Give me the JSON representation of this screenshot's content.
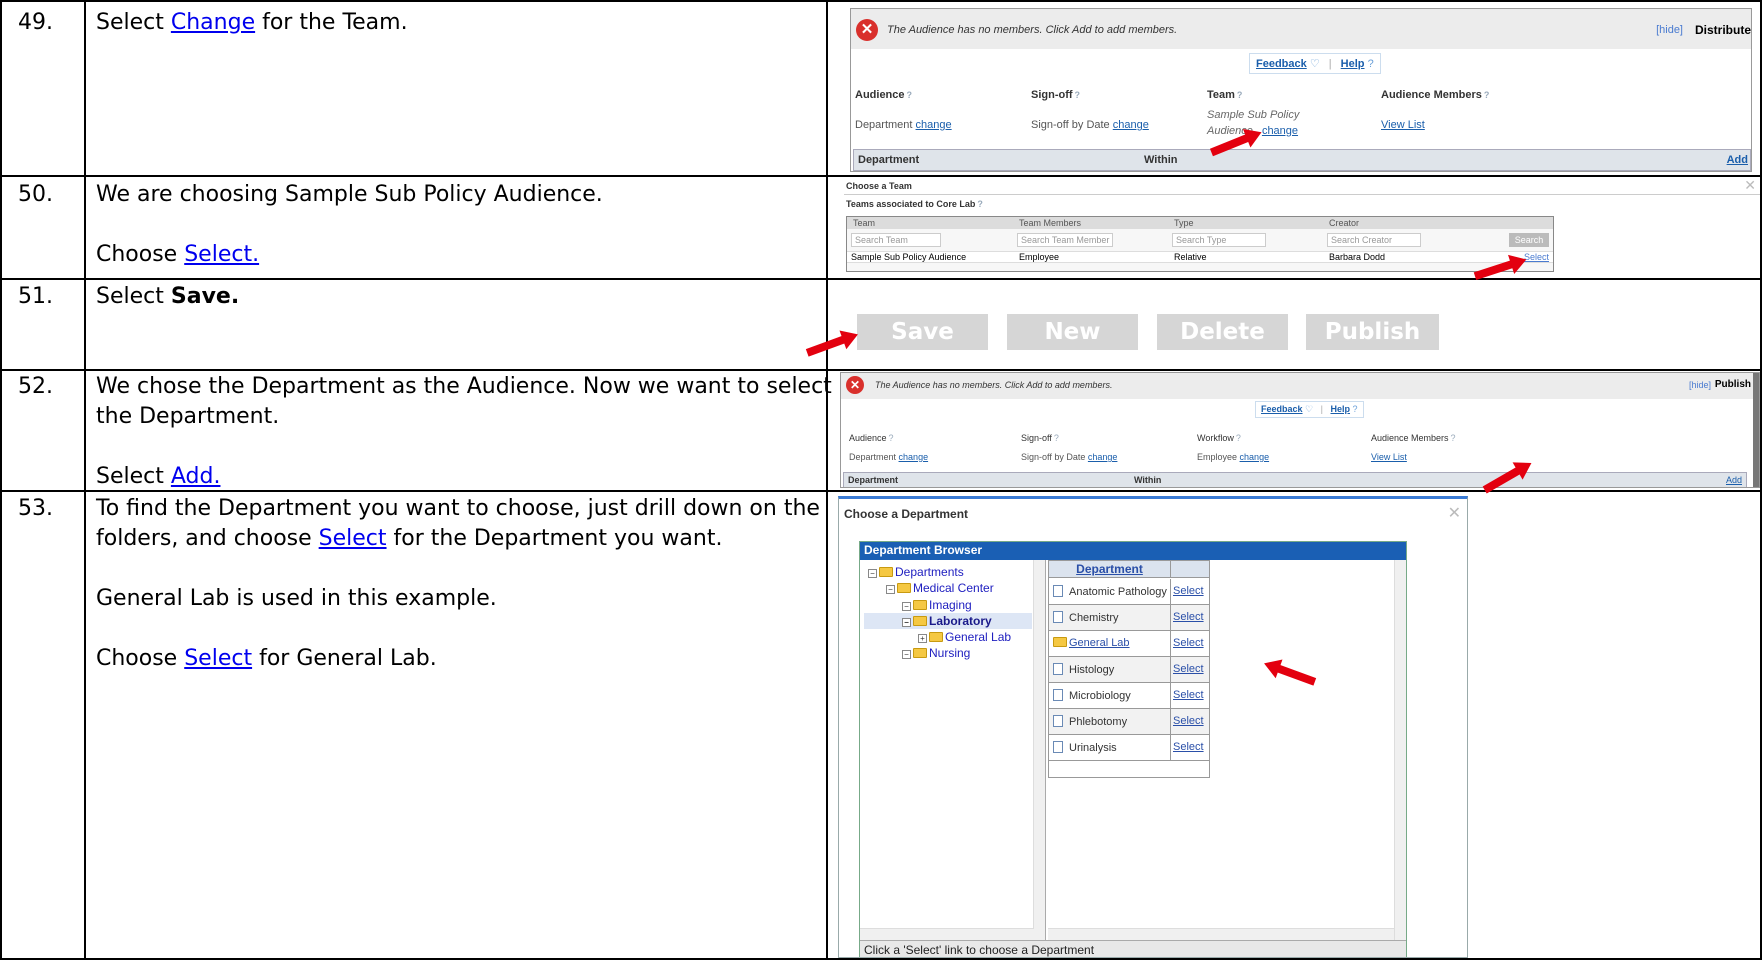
{
  "rows": [
    {
      "num": "49.",
      "text": [
        [
          {
            "t": "Select "
          },
          {
            "t": "Change",
            "link": true
          },
          {
            "t": " for the Team."
          }
        ]
      ]
    },
    {
      "num": "50.",
      "text": [
        [
          {
            "t": "We are choosing Sample Sub Policy Audience."
          }
        ],
        [],
        [
          {
            "t": "Choose "
          },
          {
            "t": "Select.",
            "link": true
          }
        ]
      ]
    },
    {
      "num": "51.",
      "text": [
        [
          {
            "t": "Select "
          },
          {
            "t": "Save.",
            "bold": true
          }
        ]
      ]
    },
    {
      "num": "52.",
      "text": [
        [
          {
            "t": "We chose the Department as the Audience.  Now we want to select"
          }
        ],
        [
          {
            "t": "the Department."
          }
        ],
        [],
        [
          {
            "t": "Select "
          },
          {
            "t": "Add.",
            "link": true
          }
        ]
      ]
    },
    {
      "num": "53.",
      "text": [
        [
          {
            "t": "To find the Department you want to choose, just drill down on the"
          }
        ],
        [
          {
            "t": "folders, and choose "
          },
          {
            "t": "Select",
            "link": true
          },
          {
            "t": " for the Department you want."
          }
        ],
        [],
        [
          {
            "t": "General Lab is used in this example."
          }
        ],
        [],
        [
          {
            "t": "Choose "
          },
          {
            "t": "Select",
            "link": true
          },
          {
            "t": " for General Lab."
          }
        ]
      ]
    }
  ],
  "s49": {
    "banner": "The Audience has no members. Click Add to add members.",
    "hide": "[hide]",
    "distribute": "Distribute",
    "feedback": "Feedback",
    "help": "Help",
    "col_audience": "Audience",
    "col_signoff": "Sign-off",
    "col_team": "Team",
    "col_members": "Audience Members",
    "val_audience": "Department",
    "val_signoff": "Sign-off by Date",
    "val_team_1": "Sample Sub Policy",
    "val_team_2": "Audience",
    "change": "change",
    "view_list": "View List",
    "bar_department": "Department",
    "bar_within": "Within",
    "bar_add": "Add"
  },
  "s50": {
    "title": "Choose a Team",
    "subtitle": "Teams associated to  Core Lab",
    "headers": [
      "Team",
      "Team Members",
      "Type",
      "Creator"
    ],
    "search_placeholders": [
      "Search Team",
      "Search Team Member",
      "Search Type",
      "Search Creator"
    ],
    "search_button": "Search",
    "row": [
      "Sample Sub Policy Audience",
      "Employee",
      "Relative",
      "Barbara Dodd"
    ],
    "select": "Select"
  },
  "s51": {
    "buttons": [
      "Save",
      "New",
      "Delete",
      "Publish"
    ]
  },
  "s52": {
    "banner": "The Audience has no members. Click Add to add members.",
    "hide": "[hide]",
    "publish": "Publish",
    "feedback": "Feedback",
    "help": "Help",
    "col_audience": "Audience",
    "col_signoff": "Sign-off",
    "col_workflow": "Workflow",
    "col_members": "Audience Members",
    "val_audience": "Department",
    "val_signoff": "Sign-off by Date",
    "val_workflow": "Employee",
    "change": "change",
    "view_list": "View List",
    "bar_department": "Department",
    "bar_within": "Within",
    "bar_add": "Add"
  },
  "s53": {
    "title": "Choose a Department",
    "browser_title": "Department Browser",
    "tree": [
      "Departments",
      "Medical Center",
      "Imaging",
      "Laboratory",
      "General Lab",
      "Nursing"
    ],
    "table_header": "Department",
    "departments": [
      "Anatomic Pathology",
      "Chemistry",
      "General Lab",
      "Histology",
      "Microbiology",
      "Phlebotomy",
      "Urinalysis"
    ],
    "select": "Select",
    "status": "Click a 'Select' link to choose a Department"
  },
  "colors": {
    "arrow": "#e3000f",
    "link": "#0000ee",
    "header_blue": "#1a5fb4"
  }
}
